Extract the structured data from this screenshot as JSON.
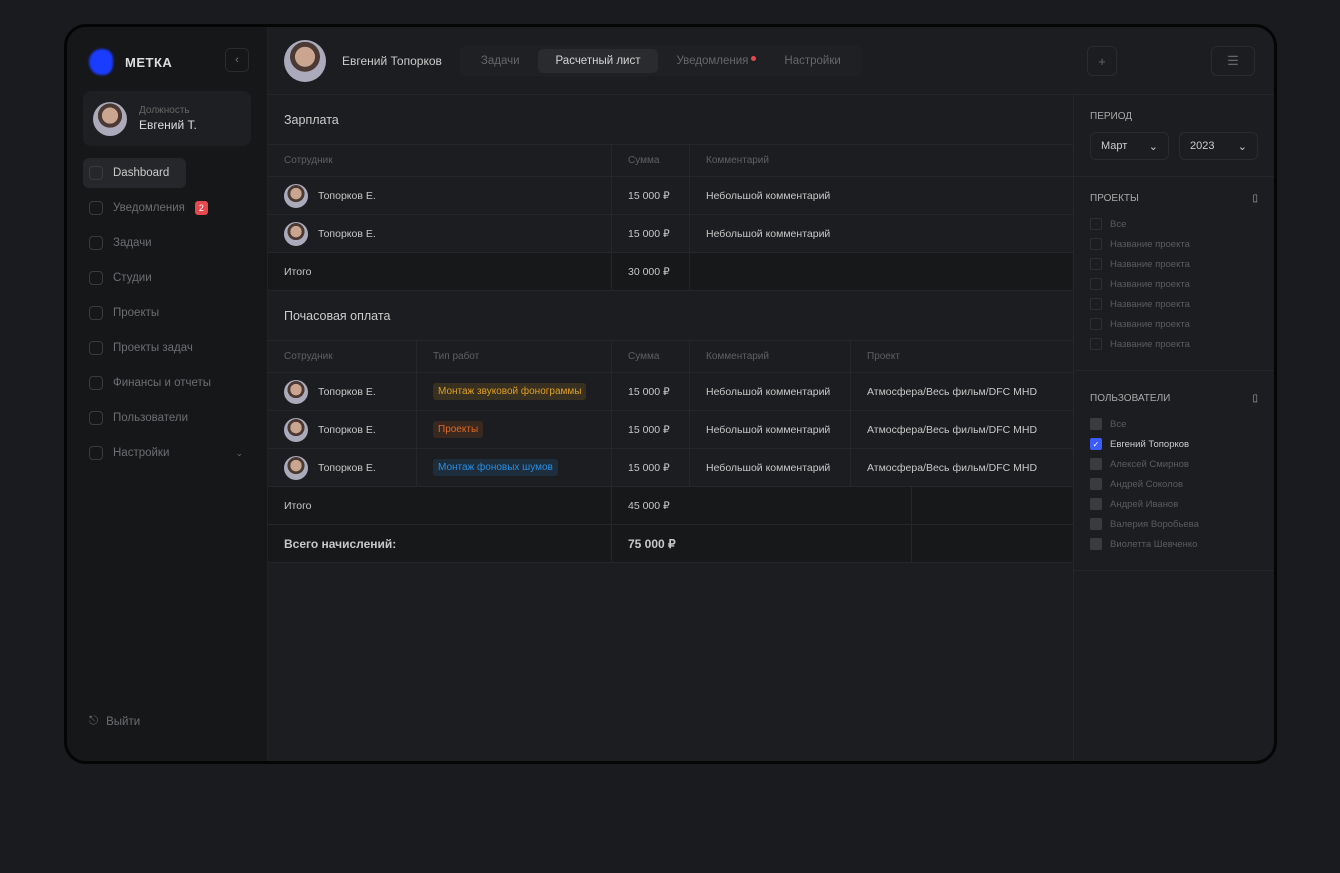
{
  "app": {
    "logo": "МЕТКА",
    "collapse_icon": "‹"
  },
  "profile": {
    "role": "Должность",
    "name": "Евгений Т."
  },
  "nav": [
    {
      "label": "Dashboard",
      "active": true
    },
    {
      "label": "Уведомления",
      "badge": "2"
    },
    {
      "label": "Задачи"
    },
    {
      "label": "Студии"
    },
    {
      "label": "Проекты"
    },
    {
      "label": "Проекты задач"
    },
    {
      "label": "Финансы и отчеты"
    },
    {
      "label": "Пользователи"
    },
    {
      "label": "Настройки",
      "chevron": "⌄"
    }
  ],
  "logout": "Выйти",
  "header": {
    "user": "Евгений Топорков",
    "tabs": [
      {
        "label": "Задачи"
      },
      {
        "label": "Расчетный лист",
        "active": true
      },
      {
        "label": "Уведомления",
        "dot": true
      },
      {
        "label": "Настройки"
      }
    ],
    "add": "+",
    "filter": "☰"
  },
  "salary": {
    "title": "Зарплата",
    "columns": [
      "Сотрудник",
      "Сумма",
      "Комментарий"
    ],
    "rows": [
      {
        "employee": "Топорков Е.",
        "sum": "15 000 ₽",
        "comment": "Небольшой комментарий"
      },
      {
        "employee": "Топорков Е.",
        "sum": "15 000 ₽",
        "comment": "Небольшой комментарий"
      }
    ],
    "total_label": "Итого",
    "total": "30 000 ₽"
  },
  "hourly": {
    "title": "Почасовая оплата",
    "columns": [
      "Сотрудник",
      "Тип работ",
      "Сумма",
      "Комментарий",
      "Проект"
    ],
    "rows": [
      {
        "employee": "Топорков Е.",
        "type": "Монтаж звуковой фонограммы",
        "color": "#e0a020",
        "sum": "15 000 ₽",
        "comment": "Небольшой комментарий",
        "project": "Атмосфера/Весь фильм/DFC MHD"
      },
      {
        "employee": "Топорков Е.",
        "type": "Проекты",
        "color": "#e06a20",
        "sum": "15 000 ₽",
        "comment": "Небольшой комментарий",
        "project": "Атмосфера/Весь фильм/DFC MHD"
      },
      {
        "employee": "Топорков Е.",
        "type": "Монтаж фоновых шумов",
        "color": "#2a8ee0",
        "sum": "15 000 ₽",
        "comment": "Небольшой комментарий",
        "project": "Атмосфера/Весь фильм/DFC MHD"
      }
    ],
    "total_label": "Итого",
    "total": "45 000 ₽",
    "grand_label": "Всего начислений:",
    "grand_total": "75 000 ₽"
  },
  "filters": {
    "period_title": "Период",
    "month": "Март",
    "year": "2023",
    "projects_title": "Проекты",
    "projects": [
      "Все",
      "Название проекта",
      "Название проекта",
      "Название проекта",
      "Название проекта",
      "Название проекта",
      "Название проекта"
    ],
    "users_title": "Пользователи",
    "users": [
      {
        "name": "Все"
      },
      {
        "name": "Евгений Топорков",
        "checked": true
      },
      {
        "name": "Алексей Смирнов"
      },
      {
        "name": "Андрей Соколов"
      },
      {
        "name": "Андрей Иванов"
      },
      {
        "name": "Валерия Воробьева"
      },
      {
        "name": "Виолетта Шевченко"
      }
    ]
  }
}
